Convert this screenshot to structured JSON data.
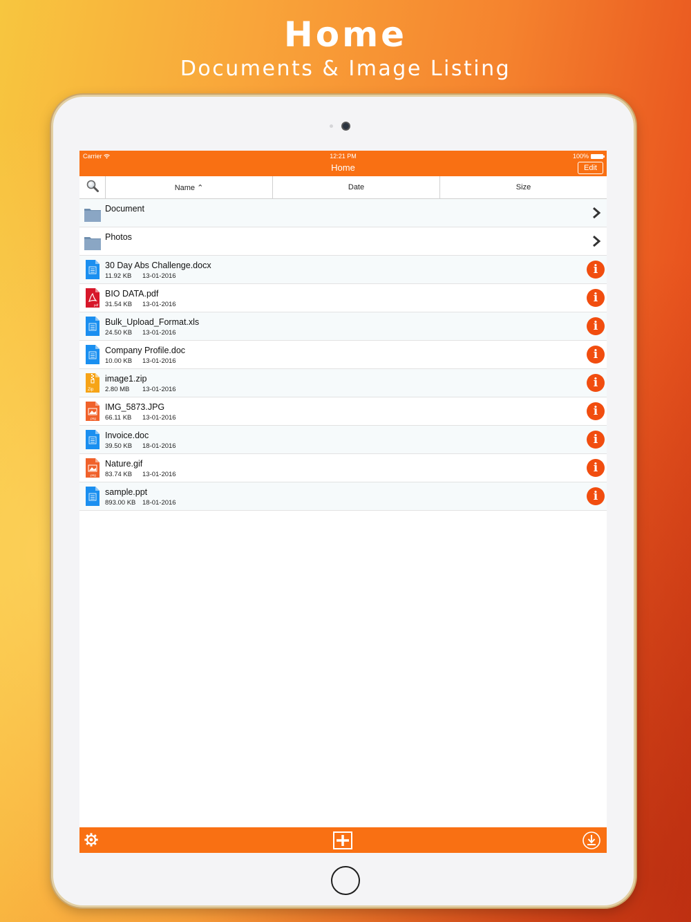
{
  "headline": {
    "title": "Home",
    "subtitle": "Documents & Image Listing"
  },
  "status": {
    "carrier": "Carrier",
    "time": "12:21 PM",
    "battery": "100%"
  },
  "nav": {
    "title": "Home",
    "edit_label": "Edit"
  },
  "sort": {
    "name": "Name ⌃",
    "date": "Date",
    "size": "Size"
  },
  "folders": [
    {
      "name": "Document"
    },
    {
      "name": "Photos"
    }
  ],
  "files": [
    {
      "name": "30 Day Abs Challenge.docx",
      "size": "11.92 KB",
      "date": "13-01-2016",
      "type": "doc"
    },
    {
      "name": "BIO DATA.pdf",
      "size": "31.54 KB",
      "date": "13-01-2016",
      "type": "pdf"
    },
    {
      "name": "Bulk_Upload_Format.xls",
      "size": "24.50 KB",
      "date": "13-01-2016",
      "type": "doc"
    },
    {
      "name": "Company Profile.doc",
      "size": "10.00 KB",
      "date": "13-01-2016",
      "type": "doc"
    },
    {
      "name": "image1.zip",
      "size": "2.80 MB",
      "date": "13-01-2016",
      "type": "zip"
    },
    {
      "name": "IMG_5873.JPG",
      "size": "66.11 KB",
      "date": "13-01-2016",
      "type": "img"
    },
    {
      "name": "Invoice.doc",
      "size": "39.50 KB",
      "date": "18-01-2016",
      "type": "doc"
    },
    {
      "name": "Nature.gif",
      "size": "83.74 KB",
      "date": "13-01-2016",
      "type": "img"
    },
    {
      "name": "sample.ppt",
      "size": "893.00 KB",
      "date": "18-01-2016",
      "type": "doc"
    }
  ],
  "icon_labels": {
    "pdf": "pdf",
    "zip": "Zip",
    "img": ".png"
  },
  "icons": {
    "search": "search-icon",
    "folder": "folder-icon",
    "chevron": "chevron-right-icon",
    "info": "info-icon",
    "settings": "gear-icon",
    "add": "plus-square-icon",
    "download": "download-icon"
  },
  "colors": {
    "accent": "#f97013",
    "info": "#f14d0f",
    "doc": "#1a8ff0",
    "pdf": "#d7172a",
    "zip": "#f6a417",
    "img": "#f0612a",
    "folder": "#7d9ab8"
  }
}
